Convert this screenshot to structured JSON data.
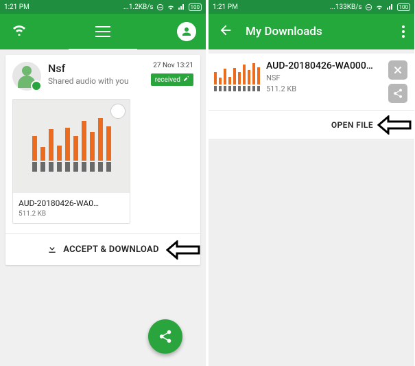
{
  "status": {
    "time": "1:21 PM",
    "net_left": "...1.2KB/s",
    "net_right": "...133KB/s",
    "battery": "100"
  },
  "left": {
    "sender": "Nsf",
    "subtitle": "Shared audio with you",
    "timestamp": "27 Nov 13:21",
    "badge": "received",
    "filename": "AUD-20180426-WA0…",
    "filesize": "511.2 KB",
    "action": "ACCEPT & DOWNLOAD"
  },
  "right": {
    "title": "My Downloads",
    "filename": "AUD-20180426-WA000…",
    "sender": "NSF",
    "filesize": "511.2 KB",
    "action": "OPEN FILE"
  },
  "wave_heights": [
    36,
    20,
    46,
    22,
    48,
    36,
    58,
    42,
    62,
    50
  ]
}
